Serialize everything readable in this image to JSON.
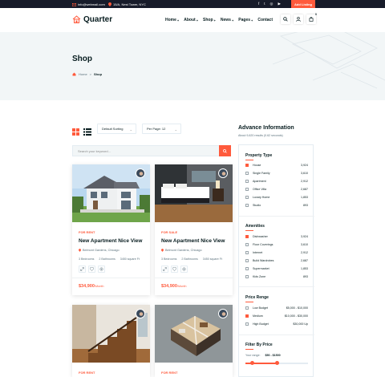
{
  "topbar": {
    "email": "info@webmail.com",
    "address": "15/A, Nest Tower, NYC",
    "social": [
      "f",
      "t",
      "◎",
      "▶"
    ],
    "add_listing": "Add Listing"
  },
  "header": {
    "logo": "Quarter",
    "nav": [
      {
        "label": "Home",
        "has_menu": true
      },
      {
        "label": "About",
        "has_menu": true
      },
      {
        "label": "Shop",
        "has_menu": true
      },
      {
        "label": "News",
        "has_menu": true
      },
      {
        "label": "Pages",
        "has_menu": true
      },
      {
        "label": "Contact",
        "has_menu": false
      }
    ],
    "cart_count": "0"
  },
  "hero": {
    "title": "Shop",
    "breadcrumb_home": "Home",
    "breadcrumb_current": "Shop"
  },
  "toolbar": {
    "sort": "Default Sorting",
    "per_page": "Per Page: 12"
  },
  "search": {
    "placeholder": "Search your keyword..."
  },
  "cards": [
    {
      "tag": "FOR RENT",
      "title": "New Apartment Nice View",
      "address": "Belmont Gardens, Chicago",
      "beds": "3 Bedrooms",
      "baths": "2 Bathrooms",
      "area": "3450 square Ft",
      "price": "$34,900",
      "period": "/Month"
    },
    {
      "tag": "FOR SALE",
      "title": "New Apartment Nice View",
      "address": "Belmont Gardens, Chicago",
      "beds": "3 Bedrooms",
      "baths": "2 Bathrooms",
      "area": "3450 square Ft",
      "price": "$34,900",
      "period": "/Month"
    },
    {
      "tag": "FOR RENT",
      "title": "",
      "address": "",
      "beds": "",
      "baths": "",
      "area": "",
      "price": "",
      "period": ""
    },
    {
      "tag": "FOR RENT",
      "title": "",
      "address": "",
      "beds": "",
      "baths": "",
      "area": "",
      "price": "",
      "period": ""
    }
  ],
  "sidebar": {
    "title": "Advance Information",
    "subtitle": "About 9,620 results (0.62 seconds)",
    "property_type": {
      "heading": "Property Type",
      "items": [
        {
          "label": "House",
          "count": "3,924",
          "checked": true
        },
        {
          "label": "Single Family",
          "count": "3,610",
          "checked": false
        },
        {
          "label": "Apartment",
          "count": "2,912",
          "checked": false
        },
        {
          "label": "Office Villa",
          "count": "2,687",
          "checked": false
        },
        {
          "label": "Luxary Home",
          "count": "1,853",
          "checked": false
        },
        {
          "label": "Studio",
          "count": "893",
          "checked": false
        }
      ]
    },
    "amenities": {
      "heading": "Amenities",
      "items": [
        {
          "label": "Dishwasher",
          "count": "3,924",
          "checked": true
        },
        {
          "label": "Floor Coverings",
          "count": "3,610",
          "checked": false
        },
        {
          "label": "Internet",
          "count": "2,912",
          "checked": false
        },
        {
          "label": "Build Wardrobes",
          "count": "2,687",
          "checked": false
        },
        {
          "label": "Supermarket",
          "count": "1,853",
          "checked": false
        },
        {
          "label": "Kids Zone",
          "count": "893",
          "checked": false
        }
      ]
    },
    "price_range": {
      "heading": "Price Renge",
      "items": [
        {
          "label": "Low Budget",
          "count": "$5,000 - $10,000",
          "checked": false
        },
        {
          "label": "Medium",
          "count": "$10,000 - $30,000",
          "checked": true
        },
        {
          "label": "High Budget",
          "count": "$30,000 Up",
          "checked": false
        }
      ]
    },
    "filter_price": {
      "heading": "Filter By Price",
      "label": "Your range:",
      "value": "$50 - $1500"
    }
  },
  "colors": {
    "accent": "#ff5a3c",
    "dark": "#171b2a",
    "light_bg": "#f2f6f7"
  }
}
